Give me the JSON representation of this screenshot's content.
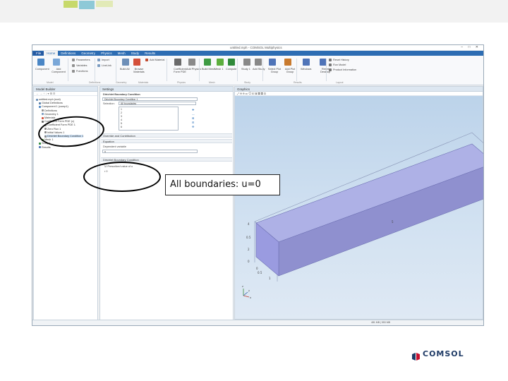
{
  "app": {
    "title": "untitled.mph - COMSOL Multiphysics",
    "window_buttons": "– □ ✕",
    "tabs": [
      "File",
      "Home",
      "Definitions",
      "Geometry",
      "Physics",
      "Mesh",
      "Study",
      "Results"
    ],
    "active_tab": "Home",
    "ribbon": {
      "items": [
        {
          "label": "Component",
          "icon_color": "#4a86c5"
        },
        {
          "label": "Add Component",
          "icon_color": "#7aa7d8"
        },
        {
          "label": "Parameters",
          "icon_color": "#8f8f8f"
        },
        {
          "label": "Variables",
          "icon_color": "#8f8f8f"
        },
        {
          "label": "Functions",
          "icon_color": "#8f8f8f"
        },
        {
          "label": "Import",
          "icon_color": "#7b9bc0"
        },
        {
          "label": "LiveLink",
          "icon_color": "#7b9bc0"
        },
        {
          "label": "Build All",
          "icon_color": "#6d8fb8"
        },
        {
          "label": "Browse Materials",
          "icon_color": "#d4503a"
        },
        {
          "label": "Add Material",
          "icon_color": "#c04a2f"
        },
        {
          "label": "Coefficient Form PDE",
          "icon_color": "#6a6a6a"
        },
        {
          "label": "Add Physics",
          "icon_color": "#8a8a8a"
        },
        {
          "label": "Build Mesh",
          "icon_color": "#3e9b43"
        },
        {
          "label": "Mesh 1",
          "icon_color": "#5cae3d"
        },
        {
          "label": "Compute",
          "icon_color": "#2f8a3a"
        },
        {
          "label": "Study 1",
          "icon_color": "#888888"
        },
        {
          "label": "Add Study",
          "icon_color": "#888888"
        },
        {
          "label": "Select Plot Group",
          "icon_color": "#4f74b8"
        },
        {
          "label": "Add Plot Group",
          "icon_color": "#c87a2e"
        },
        {
          "label": "Windows",
          "icon_color": "#4f74b8"
        },
        {
          "label": "Reset Desktop",
          "icon_color": "#4f74b8"
        },
        {
          "label": "Reset History",
          "icon_color": "#777777"
        },
        {
          "label": "Run Model",
          "icon_color": "#777777"
        },
        {
          "label": "Product Information",
          "icon_color": "#777777"
        }
      ],
      "groups": [
        "Model",
        "Definitions",
        "Geometry",
        "Materials",
        "Physics",
        "Mesh",
        "Study",
        "Results",
        "Layout"
      ]
    },
    "model_builder": {
      "title": "Model Builder",
      "tree": [
        {
          "label": "untitled.mph (root)",
          "indent": 0,
          "icon": "root-icon",
          "color": "#6a8fb8"
        },
        {
          "label": "Global Definitions",
          "indent": 1,
          "icon": "globe-icon",
          "color": "#5a7fa8"
        },
        {
          "label": "Component 1 (comp1)",
          "indent": 1,
          "icon": "component-icon",
          "color": "#4a86c5"
        },
        {
          "label": "Definitions",
          "indent": 2,
          "icon": "definitions-icon",
          "color": "#8f8f8f"
        },
        {
          "label": "Geometry 1",
          "indent": 2,
          "icon": "geometry-icon",
          "color": "#7b9bc0"
        },
        {
          "label": "Materials",
          "indent": 2,
          "icon": "materials-icon",
          "color": "#d4503a"
        },
        {
          "label": "Coefficient Form PDE (c)",
          "indent": 2,
          "icon": "pde-icon",
          "color": "#6a6a6a"
        },
        {
          "label": "Coefficient Form PDE 1",
          "indent": 3,
          "icon": "pde-node-icon",
          "color": "#888888"
        },
        {
          "label": "Zero Flux 1",
          "indent": 3,
          "icon": "flux-icon",
          "color": "#888888"
        },
        {
          "label": "Initial Values 1",
          "indent": 3,
          "icon": "init-icon",
          "color": "#888888"
        },
        {
          "label": "Dirichlet Boundary Condition 1",
          "indent": 3,
          "icon": "dirichlet-icon",
          "color": "#888888",
          "selected": true
        },
        {
          "label": "Mesh 1",
          "indent": 2,
          "icon": "mesh-icon",
          "color": "#5cae3d"
        },
        {
          "label": "Study 1",
          "indent": 1,
          "icon": "study-icon",
          "color": "#2f8a3a"
        },
        {
          "label": "Results",
          "indent": 1,
          "icon": "results-icon",
          "color": "#4f74b8"
        }
      ]
    },
    "settings": {
      "title": "Settings",
      "heading": "Dirichlet Boundary Condition",
      "label_field": "Dirichlet Boundary Condition 1",
      "selection_label": "Selection:",
      "selection_value": "All boundaries",
      "selection_list": [
        "1",
        "2",
        "3",
        "4",
        "5",
        "6"
      ],
      "sections": [
        "Override and Contribution",
        "Equation",
        "Dirichlet Boundary Condition"
      ],
      "dependent_label": "Dependent variable",
      "dependent_value": "u",
      "dirichlet_checkbox": "Prescribed value of u",
      "dirichlet_expr": "r",
      "bc_value": "0"
    },
    "graphics": {
      "title": "Graphics",
      "toolbar_glyphs": "⤢ ⊕ ⊖ ▭ ⟲ ◱ ▣ ▦ ▤ ⚙",
      "axis_labels": {
        "x": "x",
        "y": "y",
        "z": "z"
      },
      "tick_labels": [
        "10",
        "4",
        "0.5",
        "2",
        "0",
        "0.5",
        "1",
        "5",
        "0"
      ]
    },
    "status": "481 MB | 553 MB"
  },
  "annotation": {
    "callout_text": "All boundaries: u=0"
  },
  "brand": {
    "name": "COMSOL"
  }
}
